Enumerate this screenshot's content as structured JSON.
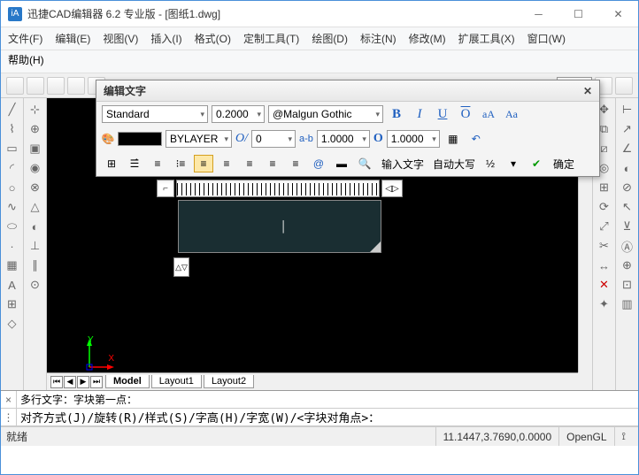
{
  "window": {
    "title": "迅捷CAD编辑器 6.2 专业版  - [图纸1.dwg]"
  },
  "menu": {
    "file": "文件(F)",
    "edit": "编辑(E)",
    "view": "视图(V)",
    "insert": "插入(I)",
    "format": "格式(O)",
    "custom_tools": "定制工具(T)",
    "draw": "绘图(D)",
    "annotate": "标注(N)",
    "modify": "修改(M)",
    "ext_tools": "扩展工具(X)",
    "window_m": "窗口(W)",
    "help": "帮助(H)"
  },
  "text_dialog": {
    "title": "编辑文字",
    "style": "Standard",
    "height": "0.2000",
    "font": "@Malgun Gothic",
    "layer_label": "BYLAYER",
    "oblique_label": "O/",
    "oblique": "0",
    "tracking_label": "a-b",
    "tracking": "1.0000",
    "width_factor": "1.0000",
    "input_text": "输入文字",
    "auto_caps": "自动大写",
    "ok": "确定"
  },
  "tabs": {
    "model": "Model",
    "layout1": "Layout1",
    "layout2": "Layout2"
  },
  "command": {
    "line1_pre": "多行文字：",
    "line1": "字块第一点：",
    "line2": "对齐方式(J)/旋转(R)/样式(S)/字高(H)/字宽(W)/<字块对角点>："
  },
  "ucs": {
    "x": "X",
    "y": "Y"
  },
  "status": {
    "ready": "就绪",
    "coords": "11.1447,3.7690,0.0000",
    "renderer": "OpenGL"
  },
  "ruler_arrows": "◁▷",
  "right_tools": {
    "er": "ER"
  }
}
